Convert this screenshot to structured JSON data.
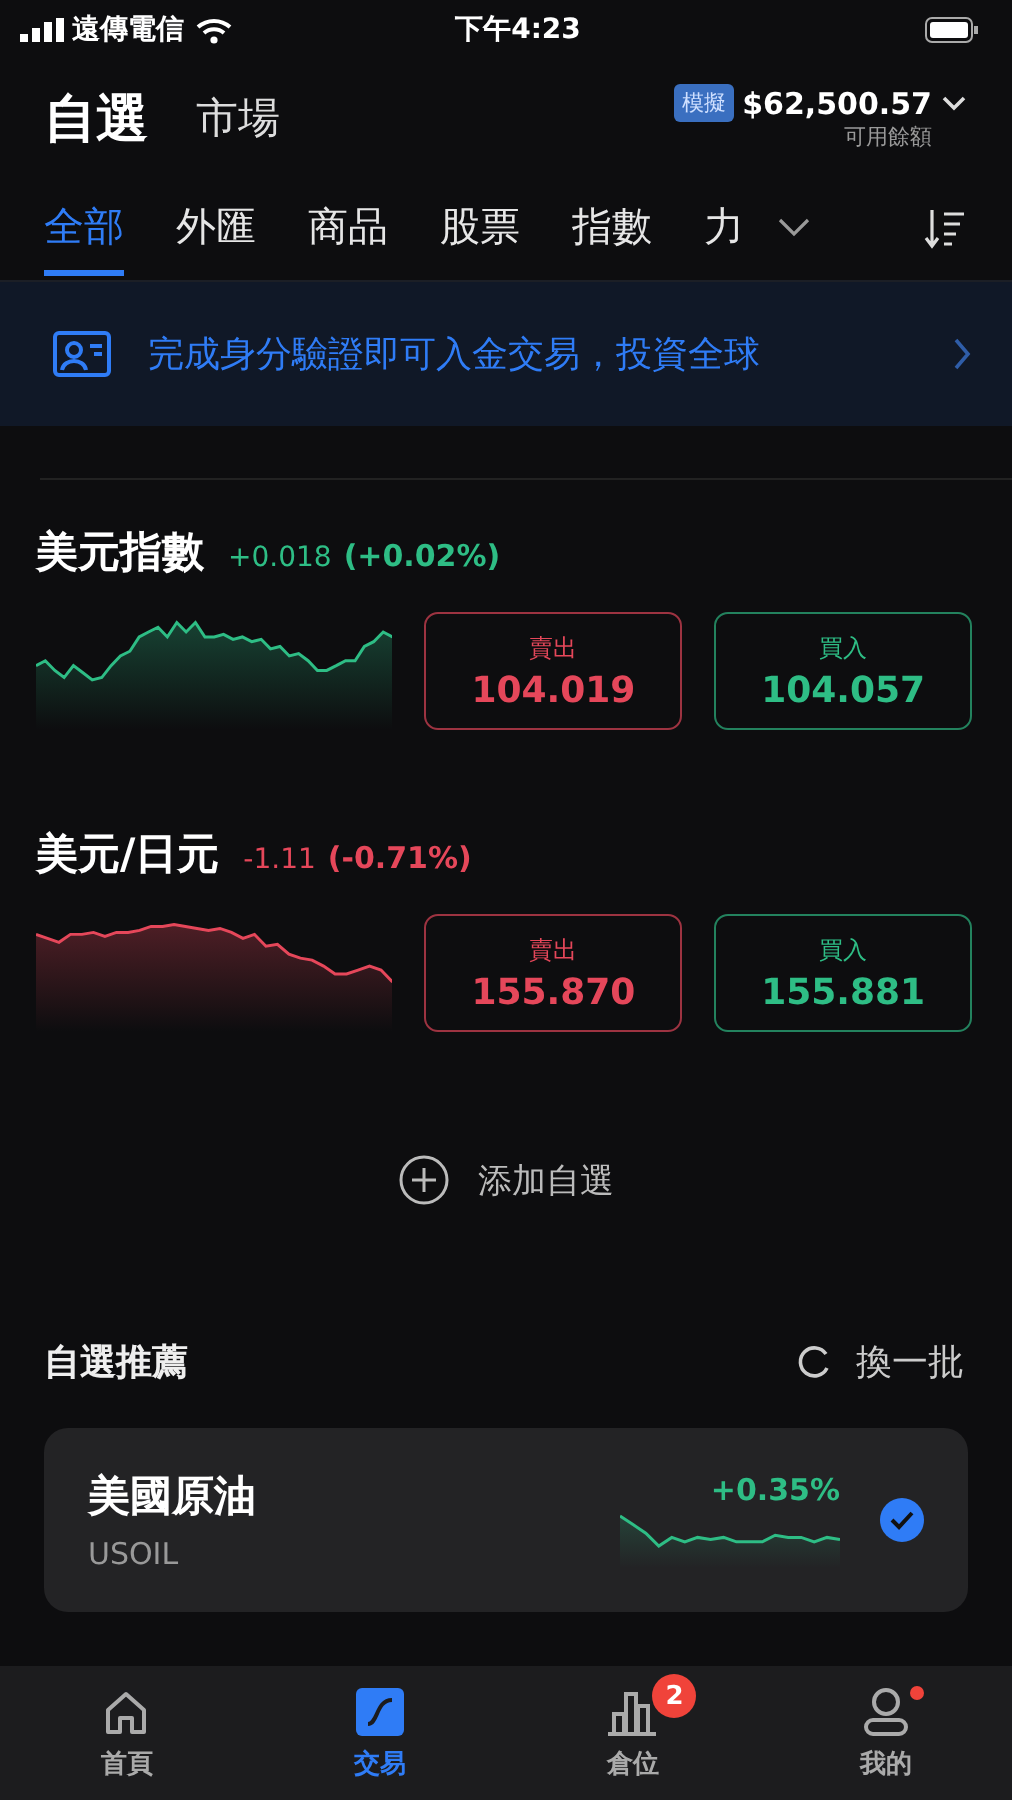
{
  "status_bar": {
    "carrier": "遠傳電信",
    "time": "下午4:23"
  },
  "header": {
    "tabs": [
      {
        "label": "自選",
        "selected": true
      },
      {
        "label": "市場",
        "selected": false
      }
    ],
    "account_badge": "模擬",
    "balance": "$62,500.57",
    "balance_label": "可用餘額"
  },
  "categories": [
    {
      "label": "全部",
      "selected": true
    },
    {
      "label": "外匯",
      "selected": false
    },
    {
      "label": "商品",
      "selected": false
    },
    {
      "label": "股票",
      "selected": false
    },
    {
      "label": "指數",
      "selected": false
    },
    {
      "label": "力",
      "selected": false
    }
  ],
  "banner": {
    "text": "完成身分驗證即可入金交易，投資全球"
  },
  "quotes": [
    {
      "name": "美元指數",
      "change": "+0.018",
      "change_pct": "(+0.02%)",
      "kind": "gain",
      "sell_label": "賣出",
      "sell": "104.019",
      "buy_label": "買入",
      "buy": "104.057"
    },
    {
      "name": "美元/日元",
      "change": "-1.11",
      "change_pct": "(-0.71%)",
      "kind": "loss",
      "sell_label": "賣出",
      "sell": "155.870",
      "buy_label": "買入",
      "buy": "155.881"
    }
  ],
  "add_button": "添加自選",
  "recommend": {
    "title": "自選推薦",
    "refresh": "換一批",
    "items": [
      {
        "name": "美國原油",
        "symbol": "USOIL",
        "change": "+0.35%",
        "kind": "gain",
        "checked": true
      }
    ]
  },
  "nav": [
    {
      "label": "首頁",
      "kind": "home",
      "selected": false
    },
    {
      "label": "交易",
      "kind": "trade",
      "selected": true
    },
    {
      "label": "倉位",
      "kind": "positions",
      "selected": false,
      "badge": "2"
    },
    {
      "label": "我的",
      "kind": "profile",
      "selected": false,
      "dot": true
    }
  ]
}
